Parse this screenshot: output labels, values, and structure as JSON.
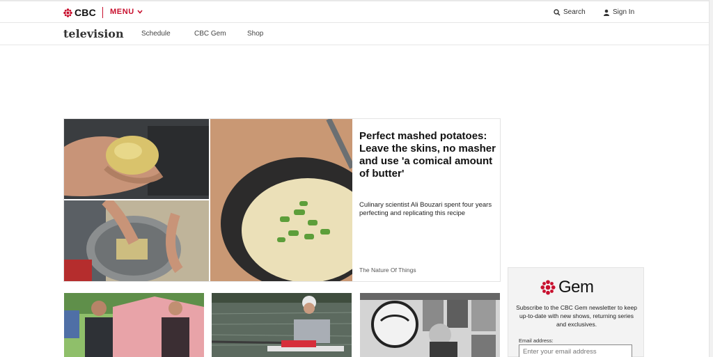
{
  "header": {
    "logo_text": "CBC",
    "menu_label": "MENU",
    "search_label": "Search",
    "signin_label": "Sign In",
    "brand_color": "#c8102e"
  },
  "subnav": {
    "brand": "television",
    "links": [
      "Schedule",
      "CBC Gem",
      "Shop"
    ]
  },
  "hero": {
    "headline": "Perfect mashed potatoes: Leave the skins, no masher and use 'a comical amount of butter'",
    "deck": "Culinary scientist Ali Bouzari spent four years perfecting and replicating this recipe",
    "source": "The Nature Of Things"
  },
  "newsletter": {
    "logo_text": "Gem",
    "description": "Subscribe to the CBC Gem newsletter to keep up-to-date with new shows, returning series and exclusives.",
    "email_label": "Email address:",
    "email_placeholder": "Enter your email address"
  },
  "icons": [
    "cbc-gem-icon",
    "chevron-down-icon",
    "search-icon",
    "user-icon"
  ]
}
